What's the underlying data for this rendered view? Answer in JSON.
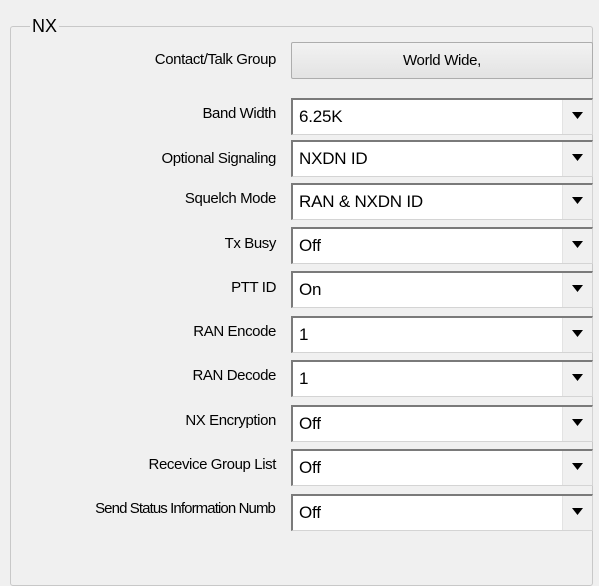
{
  "group": {
    "title": "NX"
  },
  "fields": {
    "contact_talk_group": {
      "label": "Contact/Talk Group",
      "value": "World Wide,"
    },
    "band_width": {
      "label": "Band Width",
      "value": "6.25K"
    },
    "optional_signaling": {
      "label": "Optional Signaling",
      "value": "NXDN ID"
    },
    "squelch_mode": {
      "label": "Squelch Mode",
      "value": "RAN & NXDN ID"
    },
    "tx_busy": {
      "label": "Tx Busy",
      "value": "Off"
    },
    "ptt_id": {
      "label": "PTT ID",
      "value": "On"
    },
    "ran_encode": {
      "label": "RAN Encode",
      "value": "1"
    },
    "ran_decode": {
      "label": "RAN Decode",
      "value": "1"
    },
    "nx_encryption": {
      "label": "NX Encryption",
      "value": "Off"
    },
    "receive_group_list": {
      "label": "Recevice Group List",
      "value": "Off"
    },
    "send_status_info_number": {
      "label": "Send Status Information Numb",
      "value": "Off"
    }
  },
  "icons": {
    "dropdown": "chevron-down-icon"
  }
}
